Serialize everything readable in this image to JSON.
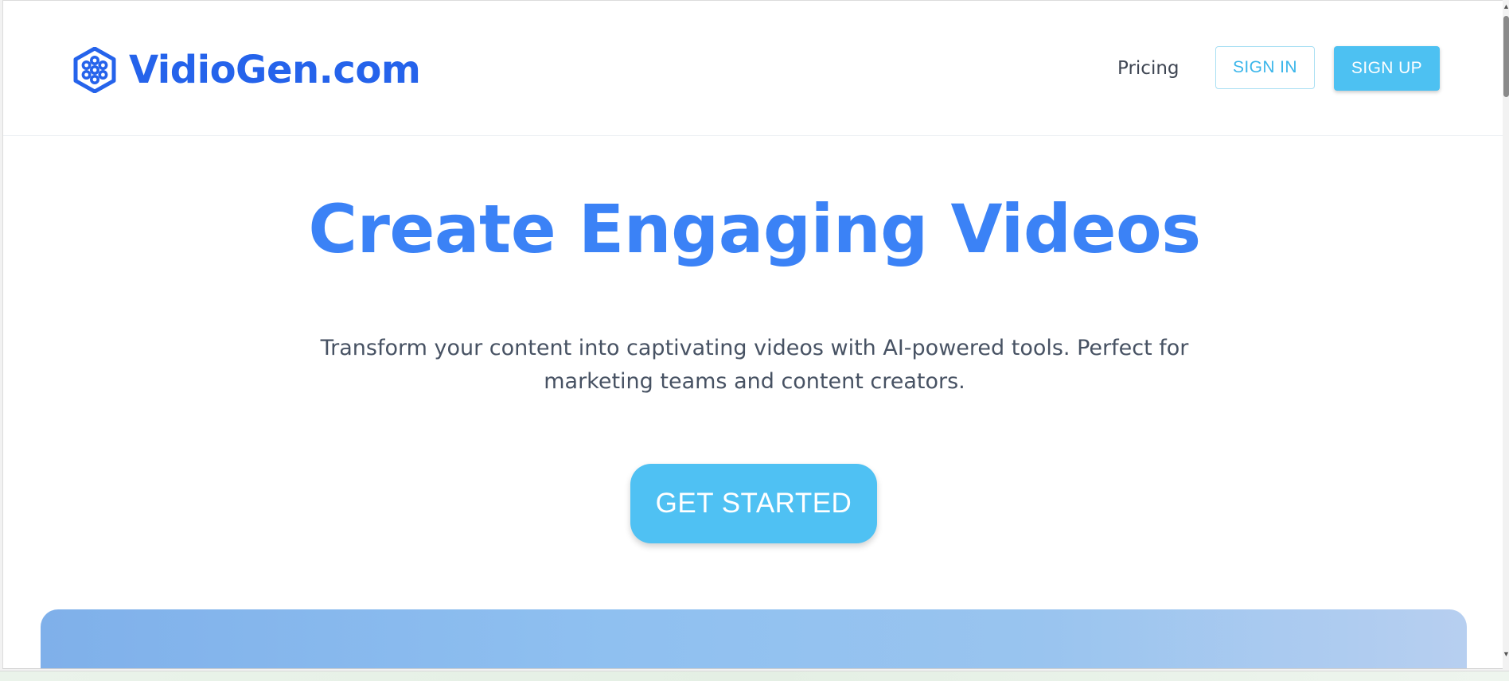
{
  "brand": {
    "name": "VidioGen.com",
    "color": "#2563eb"
  },
  "nav": {
    "pricing_label": "Pricing",
    "signin_label": "SIGN IN",
    "signup_label": "SIGN UP"
  },
  "hero": {
    "title": "Create Engaging Videos",
    "subtitle": "Transform your content into captivating videos with AI-powered tools. Perfect for marketing teams and content creators.",
    "cta_label": "GET STARTED",
    "title_color": "#3b82f6",
    "cta_color": "#4fc1f3"
  },
  "icons": {
    "logo": "hexagon-flower-icon",
    "scroll_up": "scroll-up-arrow-icon",
    "scroll_down": "scroll-down-arrow-icon"
  }
}
